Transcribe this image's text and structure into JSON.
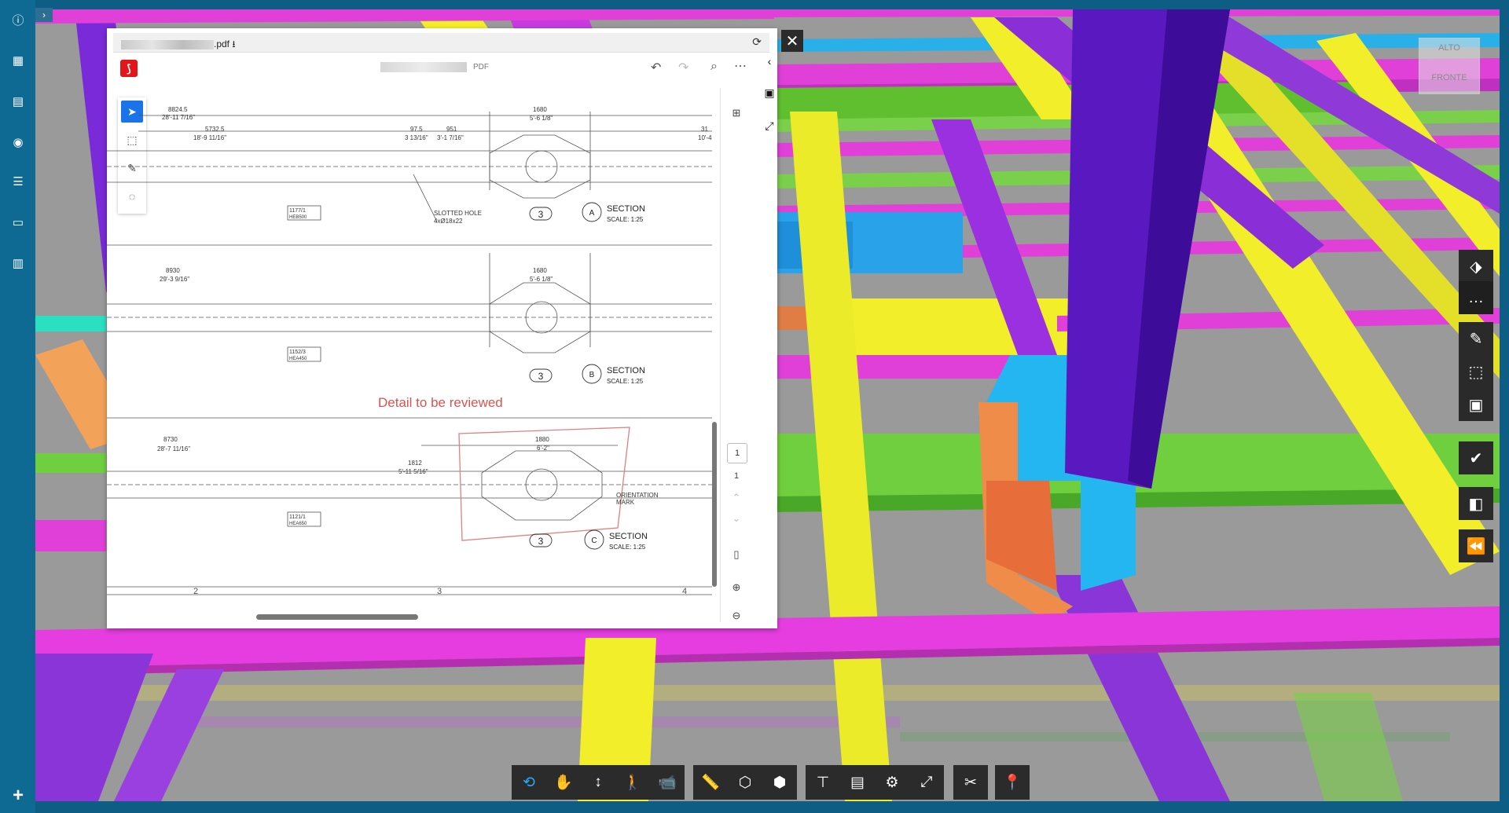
{
  "left_rail": {
    "icons": [
      "info-icon",
      "table-icon",
      "document-icon",
      "camera-icon",
      "list-icon",
      "comment-icon",
      "building-icon"
    ],
    "add_label": "+"
  },
  "viewcube": {
    "top_label": "ALTO",
    "front_label": "FRONTE"
  },
  "pdf_viewer": {
    "file_name_suffix": ".pdf",
    "doc_format": "PDF",
    "toolbar": [
      "undo-icon",
      "redo-icon",
      "search-icon",
      "more-icon"
    ],
    "left_tools": [
      "pointer-icon",
      "area-select-icon",
      "pen-icon",
      "lasso-icon"
    ],
    "page_current": "1",
    "page_total": "1",
    "drawing": {
      "dims_top": [
        {
          "main": "8824.5",
          "sub": "28'-11 7/16\""
        },
        {
          "main": "5732.5",
          "sub": "18'-9 11/16\""
        },
        {
          "main": "97.5",
          "sub": "3 13/16\""
        },
        {
          "main": "951",
          "sub": "3'-1 7/16\""
        },
        {
          "main": "1680",
          "sub": "5'-6 1/8\""
        },
        {
          "main": "31",
          "sub": "10'-4"
        }
      ],
      "tag_a": "1177/1",
      "tag_a_sub": "HEB500",
      "slotted": "SLOTTED HOLE",
      "slotted_sub": "4xØ18x22",
      "num_a": "3",
      "section_a_letter": "A",
      "section_a_title": "SECTION",
      "section_a_scale": "SCALE: 1:25",
      "dims_mid": [
        {
          "main": "8930",
          "sub": "29'-3 9/16\""
        },
        {
          "main": "1680",
          "sub": "5'-6 1/8\""
        }
      ],
      "tag_b": "1152/3",
      "tag_b_sub": "HEA450",
      "num_b": "3",
      "section_b_letter": "B",
      "section_b_title": "SECTION",
      "section_b_scale": "SCALE: 1:25",
      "review_note": "Detail to be reviewed",
      "dims_bot": [
        {
          "main": "8730",
          "sub": "28'-7 11/16\""
        },
        {
          "main": "1880",
          "sub": "6'-2\""
        },
        {
          "main": "1812",
          "sub": "5'-11 5/16\""
        }
      ],
      "orientation": "ORIENTATION",
      "orientation_sub": "MARK",
      "tag_c": "1121/1",
      "tag_c_sub": "HEA650",
      "num_c": "3",
      "section_c_letter": "C",
      "section_c_title": "SECTION",
      "section_c_scale": "SCALE: 1:25",
      "grid_labels": [
        "2",
        "3",
        "4"
      ]
    }
  },
  "right_tools": [
    "transparency-icon",
    "more-dots-icon",
    "markup-icon",
    "section-box-icon",
    "toolbox-icon",
    "approve-icon",
    "model-icon",
    "rewind-icon"
  ],
  "bottom_toolbar": {
    "groups": [
      [
        "orbit-icon",
        "pan-icon",
        "elevation-icon",
        "walk-icon",
        "camera-icon"
      ],
      [
        "measure-icon",
        "section-icon",
        "explode-icon"
      ],
      [
        "structure-icon",
        "properties-icon",
        "settings-icon",
        "fullscreen-icon"
      ],
      [
        "tools-icon"
      ],
      [
        "pin-icon"
      ]
    ]
  },
  "colors": {
    "frame": "#0e5d85",
    "magenta_beam": "#e040d8",
    "yellow_beam": "#f2ee2a",
    "green_beam": "#6fcf3e",
    "purple_column": "#6a1fd0",
    "cyan_plate": "#23b6f0",
    "orange_plate": "#f08c4a"
  }
}
